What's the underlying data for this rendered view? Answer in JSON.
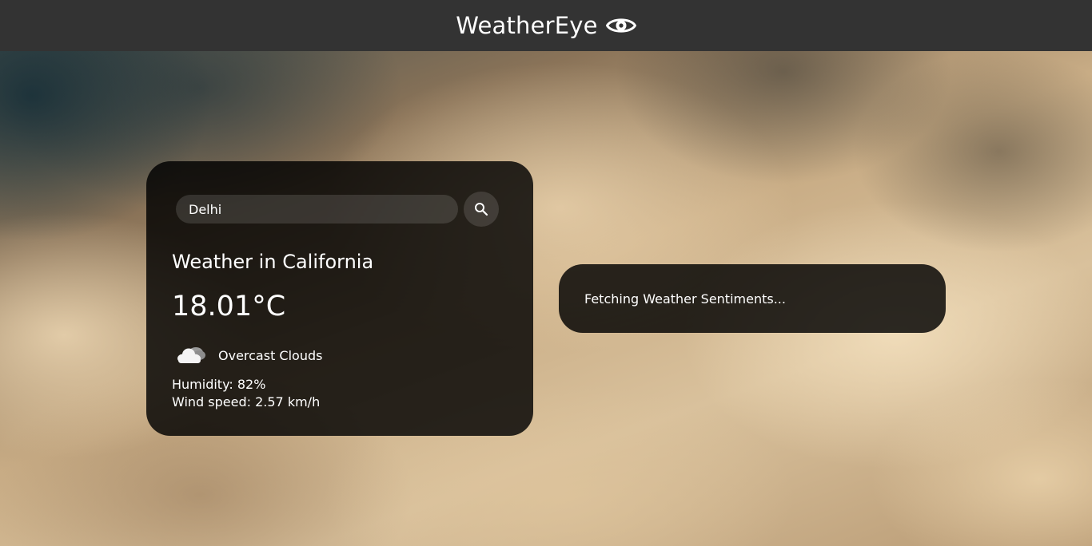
{
  "header": {
    "title": "WeatherEye",
    "logo_icon": "eye-icon"
  },
  "weather": {
    "search": {
      "value": "Delhi",
      "button_icon": "search-icon"
    },
    "city_heading": "Weather in California",
    "temperature": "18.01°C",
    "condition_icon": "cloud-icon",
    "condition": "Overcast Clouds",
    "humidity": "Humidity: 82%",
    "wind_speed": "Wind speed: 2.57 km/h"
  },
  "sentiment": {
    "status": "Fetching Weather Sentiments..."
  },
  "colors": {
    "header_bg": "#333333",
    "card_bg": "rgba(0,0,0,0.82)",
    "text": "#ffffff"
  }
}
